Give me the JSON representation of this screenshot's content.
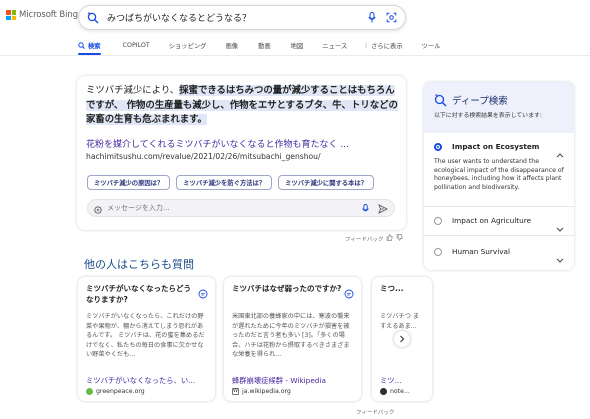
{
  "brand": {
    "name": "Microsoft Bing",
    "colors": [
      "#f25022",
      "#7fba00",
      "#00a4ef",
      "#ffb900"
    ]
  },
  "search": {
    "query": "みつばちがいなくなるとどうなる？"
  },
  "tabs": [
    {
      "label": "検索",
      "active": true
    },
    {
      "label": "COPILOT",
      "active": false
    },
    {
      "label": "ショッピング",
      "active": false
    },
    {
      "label": "画像",
      "active": false
    },
    {
      "label": "動画",
      "active": false
    },
    {
      "label": "地図",
      "active": false
    },
    {
      "label": "ニュース",
      "active": false
    },
    {
      "label": "さらに表示",
      "active": false
    },
    {
      "label": "ツール",
      "active": false
    }
  ],
  "answer": {
    "text_plain": "ミツバチ減少により、",
    "text_highlight": "採蜜できるはちみつの量が減少することはもちろんですが、 作物の生産量も減少し、作物をエサとするブタ、牛、トリなどの家畜の生育も危ぶまれます。",
    "link_title": "花粉を媒介してくれるミツバチがいなくなると作物も育たなく ...",
    "url": "hachimitsushu.com/revalue/2021/02/26/mitsubachi_genshou/",
    "chips": [
      "ミツバチ減少の原因は？",
      "ミツバチ減少を防ぐ方法は？",
      "ミツバチ減少に関する本は？"
    ],
    "chat_placeholder": "メッセージを入力...",
    "feedback": "フィードバック"
  },
  "paa": {
    "title": "他の人はこちらも質問",
    "cards": [
      {
        "question": "ミツバチがいなくなったらどうなりますか?",
        "body": "ミツバチがいなくなったら、これだけの野菜や果物が、棚から消えてしまう恐れがあるんです。 ミツバチは、花の蜜を集めるだけでなく、私たちの毎日の食事に欠かせない野菜やくだも...",
        "source": "ミツバチがいなくなったら、い...",
        "domain": "greenpeace.org",
        "fav_color": "#66bb44"
      },
      {
        "question": "ミツバチはなぜ弱ったのですか?",
        "body": "米国東北部の養蜂家の中には、寒波の襲来が遅れたために今年のミツバチが損害を被ったのだと言う者も多い [3]。「多くの場合、ハチは花粉から摂取するべきさまざまな栄養を得られ...",
        "source": "蜂群崩壊症候群 - Wikipedia",
        "domain": "ja.wikipedia.org",
        "fav_color": "#777777"
      },
      {
        "question": "ミつ...",
        "body": "ミツバチつ\nま\nすえるあま...",
        "source": "ミツ...",
        "domain": "note...",
        "fav_color": "#2e2e2e"
      }
    ],
    "feedback": "フィードバック"
  },
  "deep_search": {
    "title": "ディープ検索",
    "subtitle": "以下に対する検索結果を表示しています:",
    "options": [
      {
        "label": "Impact on Ecosystem",
        "selected": true,
        "description": "The user wants to understand the ecological impact of the disappearance of honeybees, including how it affects plant pollination and biodiversity."
      },
      {
        "label": "Impact on Agriculture",
        "selected": false
      },
      {
        "label": "Human Survival",
        "selected": false
      }
    ]
  }
}
